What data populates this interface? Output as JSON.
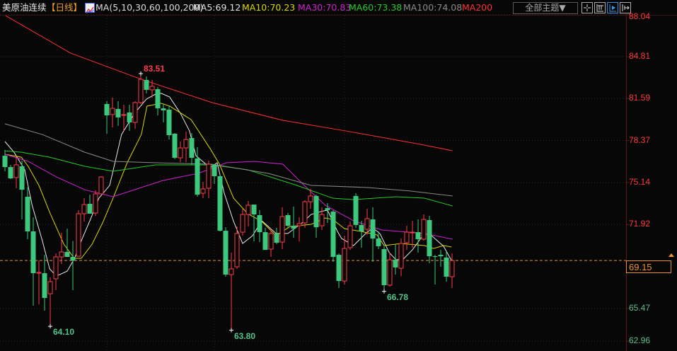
{
  "header": {
    "instrument": "美原油连续",
    "period": "【日线】",
    "ma_label": "MA(5,10,30,60,100,200)",
    "ma_values": [
      {
        "text": "MA5:69.12",
        "color": "#e0e0e0"
      },
      {
        "text": "MA10:70.23",
        "color": "#d8d800"
      },
      {
        "text": "MA30:70.83",
        "color": "#d020d0"
      },
      {
        "text": "MA60:73.38",
        "color": "#22cc22"
      },
      {
        "text": "MA100:74.08",
        "color": "#8a8a8a"
      },
      {
        "text": "MA200",
        "color": "#ff3030"
      }
    ],
    "theme_button": "全部主题▼",
    "tool_icons": [
      "crosshair-icon",
      "fit-range-icon",
      "cursor-play-icon",
      "move-right-icon"
    ]
  },
  "colors": {
    "up": "#ff3b4b",
    "down": "#3cc97d",
    "current_price": "#f0922a",
    "axis_up": "#ff3b3b",
    "axis_down": "#5fbf8c"
  },
  "chart_data": {
    "type": "candlestick",
    "y_axis": {
      "range": [
        62.96,
        88.04
      ],
      "ticks": [
        "88.04",
        "84.81",
        "81.59",
        "78.37",
        "75.14",
        "71.92",
        "65.47",
        "62.96"
      ],
      "position": "right"
    },
    "current_price": "69.15",
    "annotations": [
      {
        "text": "83.51",
        "type": "high",
        "candle": 25,
        "price": 83.51
      },
      {
        "text": "64.10",
        "type": "low",
        "candle": 9,
        "price": 64.1
      },
      {
        "text": "63.80",
        "type": "low",
        "candle": 41,
        "price": 63.8
      },
      {
        "text": "66.78",
        "type": "low",
        "candle": 68,
        "price": 66.78
      }
    ],
    "vertical_grid_candles": [
      19,
      38,
      61
    ],
    "ohlc": [
      [
        77.2,
        77.64,
        76.01,
        76.33
      ],
      [
        76.33,
        76.5,
        75.41,
        75.46
      ],
      [
        75.52,
        77.09,
        74.7,
        76.5
      ],
      [
        76.39,
        76.82,
        72.31,
        74.59
      ],
      [
        74.05,
        74.76,
        70.79,
        71.39
      ],
      [
        71.39,
        72.47,
        65.68,
        68.18
      ],
      [
        68.18,
        69.16,
        65.79,
        68.24
      ],
      [
        68.18,
        69.59,
        65.3,
        66.28
      ],
      [
        66.6,
        67.86,
        64.1,
        67.53
      ],
      [
        67.75,
        69.7,
        66.88,
        69.43
      ],
      [
        69.43,
        71.28,
        68.89,
        69.81
      ],
      [
        69.81,
        71.6,
        69.43,
        69.43
      ],
      [
        69.43,
        70.65,
        66.88,
        69.16
      ],
      [
        69.48,
        73.02,
        69.48,
        72.75
      ],
      [
        72.75,
        73.94,
        72.15,
        73.45
      ],
      [
        73.51,
        74.21,
        72.75,
        72.75
      ],
      [
        72.8,
        74.54,
        72.58,
        74.27
      ],
      [
        74.27,
        75.63,
        74.27,
        75.57
      ],
      [
        81.17,
        81.39,
        78.89,
        80.3
      ],
      [
        80.36,
        81.66,
        79.38,
        80.84
      ],
      [
        80.79,
        81.39,
        79.49,
        80.14
      ],
      [
        80.3,
        81.12,
        79.11,
        80.36
      ],
      [
        80.52,
        81.12,
        79.11,
        79.76
      ],
      [
        79.76,
        81.39,
        79.27,
        81.28
      ],
      [
        81.28,
        83.51,
        81.17,
        83.07
      ],
      [
        83.02,
        83.29,
        81.99,
        82.26
      ],
      [
        82.26,
        83.02,
        81.66,
        82.53
      ],
      [
        82.31,
        82.47,
        80.3,
        80.84
      ],
      [
        80.84,
        81.17,
        79.76,
        80.68
      ],
      [
        80.74,
        81.01,
        78.45,
        78.78
      ],
      [
        78.89,
        78.94,
        76.93,
        77.04
      ],
      [
        77.04,
        78.29,
        76.71,
        77.8
      ],
      [
        77.8,
        79.05,
        76.71,
        78.45
      ],
      [
        78.56,
        78.94,
        76.5,
        77.04
      ],
      [
        76.99,
        77.86,
        74.05,
        74.21
      ],
      [
        74.32,
        75.19,
        73.94,
        74.65
      ],
      [
        74.7,
        76.82,
        73.94,
        76.55
      ],
      [
        76.5,
        76.55,
        75.03,
        75.63
      ],
      [
        75.63,
        75.74,
        71.39,
        71.44
      ],
      [
        71.44,
        71.71,
        67.91,
        68.07
      ],
      [
        68.07,
        69.76,
        63.8,
        68.51
      ],
      [
        68.67,
        71.77,
        68.51,
        71.23
      ],
      [
        71.33,
        73.13,
        71.06,
        72.69
      ],
      [
        72.69,
        73.72,
        71.77,
        73.4
      ],
      [
        73.45,
        73.45,
        70.62,
        72.69
      ],
      [
        72.64,
        73.02,
        70.57,
        71.33
      ],
      [
        71.33,
        71.66,
        69.97,
        69.97
      ],
      [
        70.03,
        71.6,
        69.43,
        71.23
      ],
      [
        71.23,
        71.66,
        70.41,
        70.52
      ],
      [
        70.57,
        73.24,
        70.03,
        72.53
      ],
      [
        72.64,
        72.8,
        71.6,
        71.82
      ],
      [
        71.82,
        73.29,
        70.9,
        71.6
      ],
      [
        71.82,
        72.47,
        70.62,
        71.99
      ],
      [
        72.04,
        73.78,
        71.66,
        73.67
      ],
      [
        73.67,
        74.65,
        73.13,
        74.11
      ],
      [
        74.11,
        74.21,
        70.9,
        71.71
      ],
      [
        71.82,
        73.24,
        71.5,
        72.69
      ],
      [
        73.18,
        73.56,
        72.04,
        73.02
      ],
      [
        72.91,
        73.02,
        69.05,
        69.43
      ],
      [
        69.59,
        69.7,
        67.04,
        67.58
      ],
      [
        67.58,
        71.06,
        67.31,
        70.08
      ],
      [
        70.14,
        72.15,
        69.97,
        71.82
      ],
      [
        74.11,
        74.32,
        71.66,
        71.88
      ],
      [
        71.88,
        72.2,
        70.14,
        71.39
      ],
      [
        71.55,
        73.13,
        71.12,
        72.37
      ],
      [
        72.31,
        73.24,
        69.05,
        70.84
      ],
      [
        70.84,
        71.39,
        70.03,
        70.25
      ],
      [
        70.03,
        70.25,
        66.78,
        67.26
      ],
      [
        67.26,
        69.76,
        67.15,
        69.21
      ],
      [
        69.21,
        70.41,
        68.07,
        68.62
      ],
      [
        68.56,
        70.84,
        67.96,
        70.46
      ],
      [
        70.52,
        71.82,
        69.97,
        71.33
      ],
      [
        71.28,
        72.2,
        70.14,
        71.33
      ],
      [
        71.33,
        72.31,
        69.76,
        70.79
      ],
      [
        70.79,
        72.69,
        70.68,
        72.31
      ],
      [
        72.26,
        72.58,
        68.94,
        69.48
      ],
      [
        69.48,
        69.59,
        67.31,
        69.43
      ],
      [
        69.59,
        69.97,
        68.67,
        69.48
      ],
      [
        69.38,
        69.86,
        67.53,
        67.91
      ],
      [
        67.91,
        69.7,
        67.04,
        69.15
      ]
    ],
    "ma_series": [
      {
        "name": "MA5",
        "color": "#e8e8e8",
        "points": [
          [
            1,
            78.29
          ],
          [
            2.6,
            77.47
          ],
          [
            4.5,
            76.12
          ],
          [
            5.8,
            73.4
          ],
          [
            7.6,
            70.68
          ],
          [
            8.9,
            68.51
          ],
          [
            10.1,
            67.96
          ],
          [
            12,
            68.34
          ],
          [
            13.3,
            69.32
          ],
          [
            14.5,
            70.68
          ],
          [
            16.1,
            72.31
          ],
          [
            17.6,
            73.94
          ],
          [
            19.5,
            74.92
          ],
          [
            21.6,
            78.83
          ],
          [
            23.9,
            80.46
          ],
          [
            26,
            81.55
          ],
          [
            27.6,
            81.93
          ],
          [
            28.6,
            81.99
          ],
          [
            30.1,
            81.71
          ],
          [
            32,
            80.46
          ],
          [
            33.6,
            79.11
          ],
          [
            34.75,
            77.2
          ],
          [
            37.25,
            76.28
          ],
          [
            38.5,
            76.66
          ],
          [
            39.75,
            74.32
          ],
          [
            41.4,
            72.15
          ],
          [
            43,
            70.46
          ],
          [
            44.75,
            71.06
          ],
          [
            46.4,
            72.2
          ],
          [
            48.9,
            71.23
          ],
          [
            51,
            71.23
          ],
          [
            53.5,
            72.04
          ],
          [
            55.1,
            72.69
          ],
          [
            57.25,
            72.96
          ],
          [
            58,
            73.02
          ],
          [
            59.75,
            71.39
          ],
          [
            60.5,
            70.84
          ],
          [
            62.6,
            70.3
          ],
          [
            64.75,
            71.23
          ],
          [
            66,
            71.66
          ],
          [
            67.25,
            71.23
          ],
          [
            68.9,
            69.76
          ],
          [
            70.1,
            69.21
          ],
          [
            71.4,
            69.27
          ],
          [
            73,
            69.97
          ],
          [
            75.1,
            71.23
          ],
          [
            76.4,
            71.06
          ],
          [
            78.5,
            70.25
          ],
          [
            79.9,
            69.16
          ]
        ]
      },
      {
        "name": "MA10",
        "color": "#d8d800",
        "points": [
          [
            1,
            77.31
          ],
          [
            3.9,
            77.09
          ],
          [
            5.1,
            76.39
          ],
          [
            7,
            74.92
          ],
          [
            8.9,
            72.86
          ],
          [
            11.4,
            70.41
          ],
          [
            13.25,
            69.32
          ],
          [
            14.5,
            69.32
          ],
          [
            16.4,
            70.41
          ],
          [
            18.25,
            72.04
          ],
          [
            20.1,
            73.94
          ],
          [
            22.6,
            76.66
          ],
          [
            25.1,
            78.83
          ],
          [
            26.1,
            81.01
          ],
          [
            28.6,
            81.23
          ],
          [
            30.1,
            81.01
          ],
          [
            33.9,
            79.97
          ],
          [
            37.25,
            77.75
          ],
          [
            38.9,
            76.55
          ],
          [
            41.4,
            73.94
          ],
          [
            43.9,
            72.75
          ],
          [
            46.4,
            72.15
          ],
          [
            48.9,
            71.06
          ],
          [
            51.4,
            71.77
          ],
          [
            55.1,
            71.93
          ],
          [
            57.6,
            72.42
          ],
          [
            58.9,
            72.31
          ],
          [
            61,
            71.6
          ],
          [
            63.9,
            71.39
          ],
          [
            66.75,
            71.12
          ],
          [
            68,
            70.3
          ],
          [
            71,
            70.46
          ],
          [
            75.1,
            70.3
          ],
          [
            76.75,
            70.08
          ],
          [
            78.5,
            70.3
          ],
          [
            79.9,
            70.19
          ]
        ]
      },
      {
        "name": "MA30",
        "color": "#d020d0",
        "points": [
          [
            1,
            77.31
          ],
          [
            5.1,
            76.77
          ],
          [
            10.1,
            75.57
          ],
          [
            15.1,
            74.59
          ],
          [
            20.1,
            74.05
          ],
          [
            28.9,
            75.3
          ],
          [
            35.1,
            75.84
          ],
          [
            40.1,
            76.66
          ],
          [
            45.1,
            76.77
          ],
          [
            50.1,
            76.55
          ],
          [
            53.9,
            74.92
          ],
          [
            57.6,
            73.4
          ],
          [
            62.6,
            72.2
          ],
          [
            67.6,
            71.5
          ],
          [
            75.1,
            71.23
          ],
          [
            80.1,
            70.79
          ]
        ]
      },
      {
        "name": "MA60",
        "color": "#22cc22",
        "points": [
          [
            1,
            77.58
          ],
          [
            3.9,
            77.47
          ],
          [
            8.9,
            77.09
          ],
          [
            15.1,
            76.39
          ],
          [
            20.1,
            76.01
          ],
          [
            27.6,
            76.5
          ],
          [
            37.6,
            76.5
          ],
          [
            43.9,
            76.12
          ],
          [
            52.6,
            74.92
          ],
          [
            58.9,
            73.94
          ],
          [
            62.6,
            73.83
          ],
          [
            70.1,
            74.05
          ],
          [
            75.1,
            73.94
          ],
          [
            80.1,
            73.34
          ]
        ]
      },
      {
        "name": "MA100",
        "color": "#8a8a8a",
        "points": [
          [
            1,
            79.65
          ],
          [
            7.6,
            78.83
          ],
          [
            15.1,
            77.47
          ],
          [
            20.1,
            76.77
          ],
          [
            27.6,
            76.66
          ],
          [
            37.6,
            76.55
          ],
          [
            47.6,
            75.84
          ],
          [
            55.1,
            74.92
          ],
          [
            65.1,
            74.76
          ],
          [
            72.6,
            74.49
          ],
          [
            80.1,
            74.11
          ]
        ]
      },
      {
        "name": "MA200",
        "color": "#ff3030",
        "points": [
          [
            1.1,
            87.96
          ],
          [
            12.6,
            85.08
          ],
          [
            25.1,
            83.07
          ],
          [
            37.6,
            81.28
          ],
          [
            50.1,
            79.92
          ],
          [
            62.6,
            79.0
          ],
          [
            75.1,
            78.02
          ],
          [
            80.1,
            77.58
          ]
        ]
      }
    ]
  }
}
